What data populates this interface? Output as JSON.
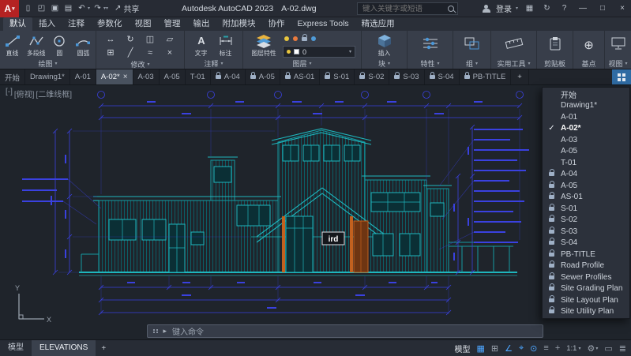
{
  "icons": {
    "caret_down": "▾",
    "check": "✓",
    "close": "×",
    "plus": "+",
    "minimize": "—",
    "maximize": "□",
    "help": "?",
    "new": "▯",
    "open": "◰",
    "save": "▣",
    "plot": "▤",
    "undo": "↶",
    "redo": "↷",
    "share": "↗",
    "apps": "▦",
    "sync": "↻",
    "prompt": "▸",
    "text_tool": "A",
    "basepoint": "⊕",
    "customize": "≣"
  },
  "titlebar": {
    "logo": "A",
    "share": "共享",
    "app_title": "Autodesk AutoCAD 2023",
    "doc_title": "A-02.dwg",
    "search_placeholder": "键入关键字或短语",
    "signin": "登录"
  },
  "menubar": {
    "tabs": [
      "默认",
      "插入",
      "注释",
      "参数化",
      "视图",
      "管理",
      "输出",
      "附加模块",
      "协作",
      "Express Tools",
      "精选应用"
    ]
  },
  "ribbon": {
    "panels": [
      "绘图",
      "修改",
      "注释",
      "图层",
      "块",
      "特性",
      "组",
      "实用工具",
      "剪贴板",
      "基点",
      "视图"
    ],
    "tools": {
      "line": "直线",
      "polyline": "多段线",
      "circle": "圆",
      "arc": "圆弧",
      "text": "文字",
      "dimension": "标注",
      "layer_props": "图层特性",
      "insert": "插入"
    },
    "layer_value": "0",
    "modify_icons": [
      "↔",
      "↻",
      "◫",
      "▱",
      "⊞",
      "╱",
      "≈",
      "×"
    ]
  },
  "doc_tabs": [
    {
      "label": "开始"
    },
    {
      "label": "Drawing1*"
    },
    {
      "label": "A-01"
    },
    {
      "label": "A-02*"
    },
    {
      "label": "A-03"
    },
    {
      "label": "A-05"
    },
    {
      "label": "T-01"
    },
    {
      "label": "A-04"
    },
    {
      "label": "A-05"
    },
    {
      "label": "AS-01"
    },
    {
      "label": "S-01"
    },
    {
      "label": "S-02"
    },
    {
      "label": "S-03"
    },
    {
      "label": "S-04"
    },
    {
      "label": "PB-TITLE"
    }
  ],
  "file_menu": [
    {
      "label": "开始"
    },
    {
      "label": "Drawing1*"
    },
    {
      "label": "A-01"
    },
    {
      "label": "A-02*"
    },
    {
      "label": "A-03"
    },
    {
      "label": "A-05"
    },
    {
      "label": "T-01"
    },
    {
      "label": "A-04"
    },
    {
      "label": "A-05"
    },
    {
      "label": "AS-01"
    },
    {
      "label": "S-01"
    },
    {
      "label": "S-02"
    },
    {
      "label": "S-03"
    },
    {
      "label": "S-04"
    },
    {
      "label": "PB-TITLE"
    },
    {
      "label": "Road Profile"
    },
    {
      "label": "Sewer Profiles"
    },
    {
      "label": "Site Grading Plan"
    },
    {
      "label": "Site Layout Plan"
    },
    {
      "label": "Site Utility Plan"
    }
  ],
  "viewport": {
    "controls": [
      "[-]",
      "[俯视]",
      "[二维线框]"
    ],
    "ucs_x": "X",
    "ucs_y": "Y"
  },
  "drawing": {
    "sign_text": "ird"
  },
  "command": {
    "placeholder": "键入命令"
  },
  "statusbar": {
    "model_space_tab": "模型",
    "layout_tab": "ELEVATIONS",
    "add_layout": "+",
    "model_button": "模型",
    "scale": "1:1",
    "icons": [
      {
        "name": "grid",
        "glyph": "▦"
      },
      {
        "name": "snap",
        "glyph": "⊞"
      },
      {
        "name": "polar-tracking",
        "glyph": "∠"
      },
      {
        "name": "object-snap",
        "glyph": "⌖"
      },
      {
        "name": "object-snap-tracking",
        "glyph": "⊙"
      },
      {
        "name": "lineweight",
        "glyph": "≡"
      },
      {
        "name": "dynamic-input",
        "glyph": "+"
      },
      {
        "name": "isolate-objects",
        "glyph": "▭"
      }
    ]
  },
  "colors": {
    "accent_blue": "#4da6ff",
    "dim_blue": "#3a41e0",
    "teal": "#1fb6bd",
    "ribbon_bg": "#383e4a",
    "canvas_bg": "#1f242b",
    "logo_red": "#b42222"
  }
}
